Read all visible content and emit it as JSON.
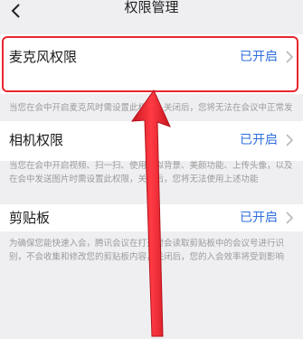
{
  "header": {
    "title": "权限管理"
  },
  "permissions": [
    {
      "title": "麦克风权限",
      "status": "已开启",
      "description": "当您在会中开启麦克风时需设置此权限，关闭后，您将无法在会议中正常发言"
    },
    {
      "title": "相机权限",
      "status": "已开启",
      "description": "当您在会中开启视频、扫一扫、使用虚拟背景、美颜功能、上传头像，以及在会中发送图片时需设置此权限，关闭后，您将无法使用上述功能"
    },
    {
      "title": "剪贴板",
      "status": "已开启",
      "description": "为确保您能快速入会，腾讯会议在打开时会读取剪贴板中的会议号进行识别，不会收集和修改您的剪贴板内容，关闭后，您的入会效率将受到影响"
    }
  ],
  "annotation": {
    "color": "#e8262f"
  }
}
